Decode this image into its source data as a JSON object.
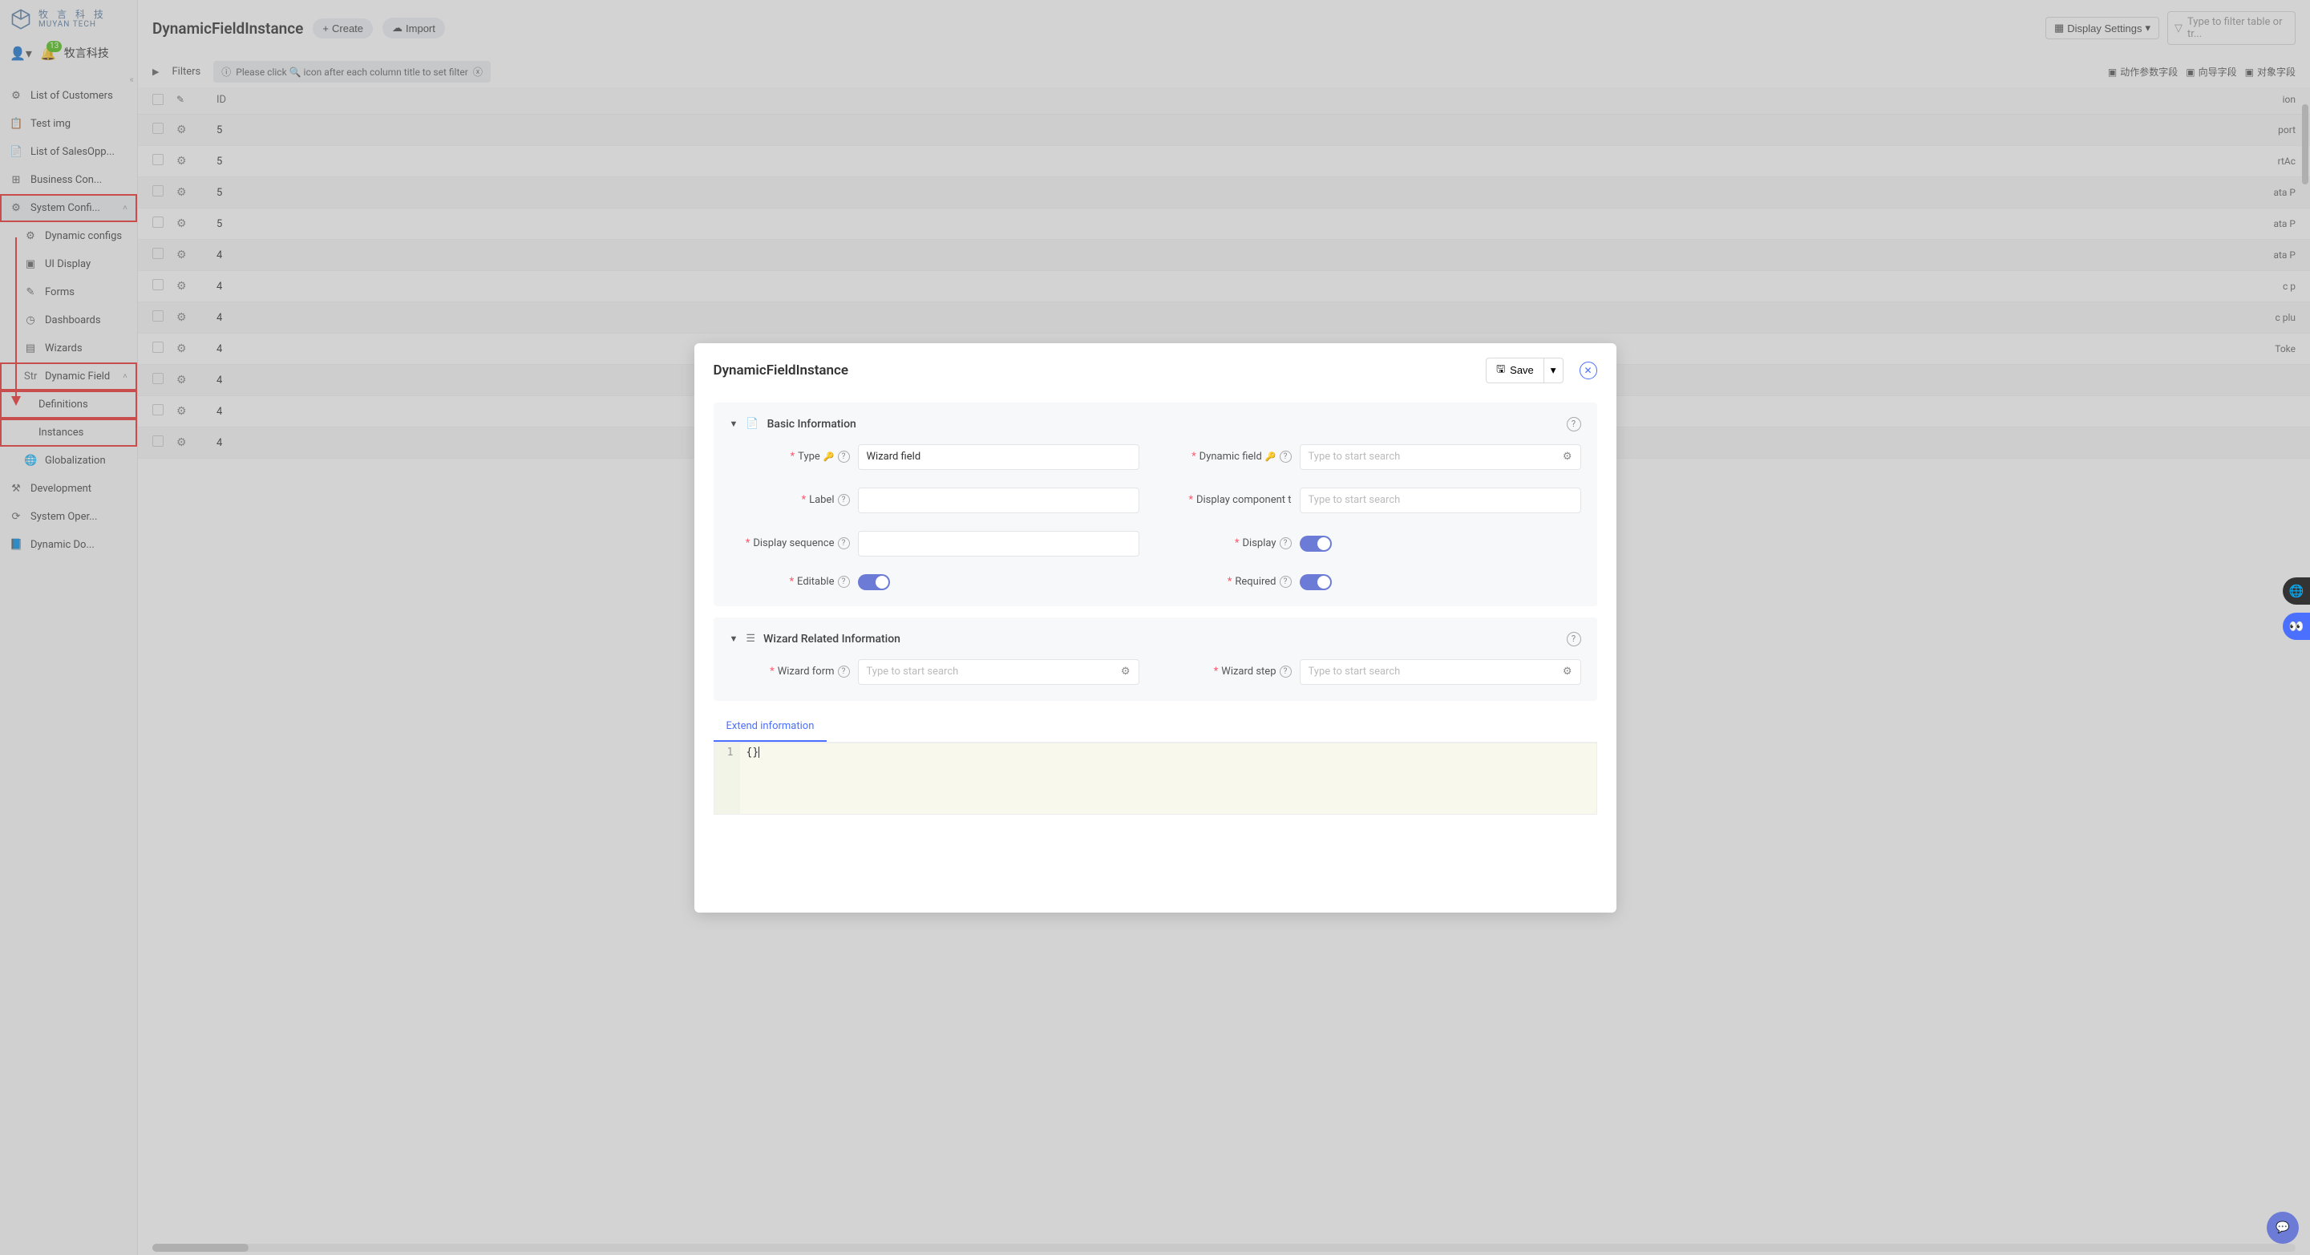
{
  "brand": {
    "cn": "牧 言 科 技",
    "en": "MUYAN TECH"
  },
  "user": {
    "name": "牧言科技",
    "notifCount": "13"
  },
  "sidebar": {
    "items": [
      {
        "icon": "⚙",
        "label": "List of Customers"
      },
      {
        "icon": "📋",
        "label": "Test img"
      },
      {
        "icon": "📄",
        "label": "List of SalesOpp..."
      },
      {
        "icon": "⊞",
        "label": "Business Con..."
      },
      {
        "icon": "⚙",
        "label": "System Confi...",
        "expandable": true,
        "redbox": true
      },
      {
        "icon": "⚙",
        "label": "Dynamic configs",
        "sub": true
      },
      {
        "icon": "▣",
        "label": "UI Display",
        "sub": true
      },
      {
        "icon": "✎",
        "label": "Forms",
        "sub": true
      },
      {
        "icon": "◷",
        "label": "Dashboards",
        "sub": true
      },
      {
        "icon": "▤",
        "label": "Wizards",
        "sub": true
      },
      {
        "icon": "Str",
        "label": "Dynamic Field",
        "sub": true,
        "expandable": true,
        "redbox": true
      },
      {
        "icon": "",
        "label": "Definitions",
        "subsub": true,
        "redbox": true
      },
      {
        "icon": "",
        "label": "Instances",
        "subsub": true,
        "redbox": true
      },
      {
        "icon": "🌐",
        "label": "Globalization",
        "sub": true
      },
      {
        "icon": "⚒",
        "label": "Development"
      },
      {
        "icon": "⟳",
        "label": "System Oper..."
      },
      {
        "icon": "📘",
        "label": "Dynamic Do..."
      }
    ]
  },
  "page": {
    "title": "DynamicFieldInstance",
    "createLabel": "Create",
    "importLabel": "Import",
    "displaySettingsLabel": "Display Settings",
    "filterPlaceholder": "Type to filter table or tr...",
    "filtersLabel": "Filters",
    "hintText": "Please click 🔍 icon after each column title to set filter",
    "rightLinks": [
      "动作参数字段",
      "向导字段",
      "对象字段"
    ],
    "cols": [
      "",
      "",
      "ID",
      "ion"
    ],
    "rows": [
      {
        "id": "5",
        "end": "port"
      },
      {
        "id": "5",
        "end": "rtAc"
      },
      {
        "id": "5",
        "end": "ata P"
      },
      {
        "id": "5",
        "end": "ata P"
      },
      {
        "id": "4",
        "end": "ata P"
      },
      {
        "id": "4",
        "end": "c p"
      },
      {
        "id": "4",
        "end": "c plu"
      },
      {
        "id": "4",
        "end": "Toke"
      },
      {
        "id": "4",
        "end": ""
      },
      {
        "id": "4",
        "end": ""
      },
      {
        "id": "4",
        "end": ""
      }
    ]
  },
  "modal": {
    "title": "DynamicFieldInstance",
    "saveLabel": "Save",
    "sections": {
      "basic": {
        "title": "Basic Information"
      },
      "wizard": {
        "title": "Wizard Related Information"
      }
    },
    "fields": {
      "type": {
        "label": "Type",
        "value": "Wizard field"
      },
      "dynamicField": {
        "label": "Dynamic field",
        "placeholder": "Type to start search"
      },
      "labelField": {
        "label": "Label"
      },
      "displayComponent": {
        "label": "Display component t",
        "placeholder": "Type to start search"
      },
      "displaySequence": {
        "label": "Display sequence"
      },
      "display": {
        "label": "Display",
        "on": true
      },
      "editable": {
        "label": "Editable",
        "on": true
      },
      "required": {
        "label": "Required",
        "on": true
      },
      "wizardForm": {
        "label": "Wizard form",
        "placeholder": "Type to start search"
      },
      "wizardStep": {
        "label": "Wizard step",
        "placeholder": "Type to start search"
      }
    },
    "tab": "Extend information",
    "code": {
      "line": "1",
      "body": "{}"
    }
  }
}
